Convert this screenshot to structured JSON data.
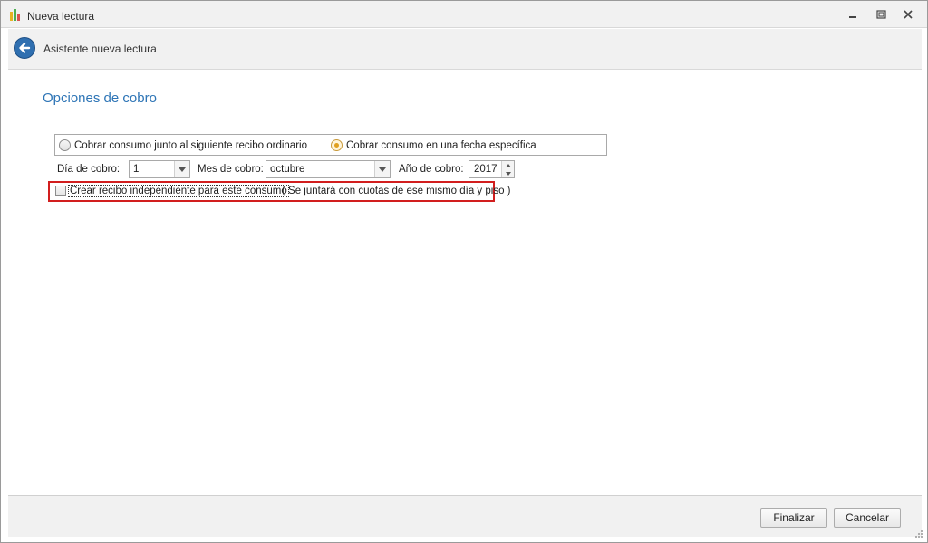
{
  "window": {
    "title": "Nueva lectura",
    "icon": "bar-chart-app-icon"
  },
  "header": {
    "title": "Asistente nueva lectura",
    "back_icon": "back-arrow-icon"
  },
  "section": {
    "title": "Opciones de cobro"
  },
  "payment_mode": {
    "options": [
      {
        "label": "Cobrar consumo junto al siguiente recibo ordinario",
        "selected": false
      },
      {
        "label": "Cobrar consumo en una fecha específica",
        "selected": true
      }
    ]
  },
  "fields": {
    "day_label": "Día de cobro:",
    "day_value": "1",
    "month_label": "Mes de cobro:",
    "month_value": "octubre",
    "year_label": "Año de cobro:",
    "year_value": "2017"
  },
  "independent_receipt": {
    "label": "Crear recibo independiente para este consumo",
    "checked": false,
    "hint": "( Se juntará con cuotas de ese mismo día y piso )"
  },
  "footer": {
    "finish_label": "Finalizar",
    "cancel_label": "Cancelar"
  },
  "colors": {
    "accent": "#2e75b6",
    "highlight_border": "#d21e1e",
    "radio_checked": "#e0a020"
  }
}
